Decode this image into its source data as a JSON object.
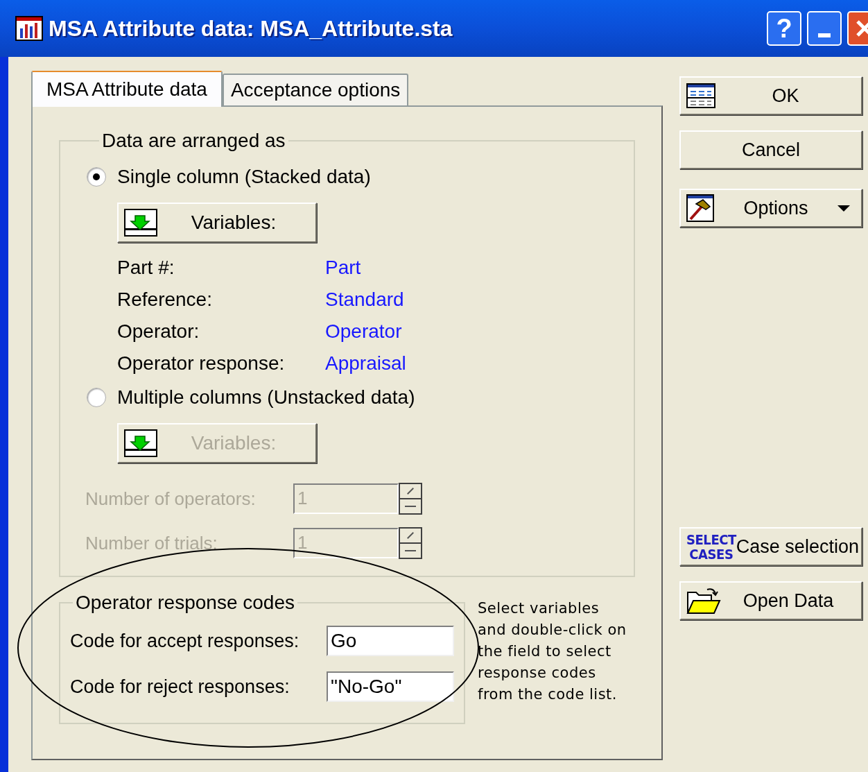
{
  "window": {
    "title": "MSA Attribute data: MSA_Attribute.sta"
  },
  "title_buttons": [
    {
      "kind": "help",
      "label": "?"
    },
    {
      "kind": "minimize"
    },
    {
      "kind": "close"
    }
  ],
  "tabs": [
    {
      "label": "MSA Attribute data",
      "selected": true
    },
    {
      "label": "Acceptance options",
      "selected": false
    }
  ],
  "arrangement": {
    "title": "Data are arranged as",
    "options": [
      {
        "label": "Single column (Stacked data)",
        "selected": true,
        "button": {
          "label": "Variables:",
          "disabled": false
        },
        "variables": [
          {
            "label": "Part #:",
            "value": "Part"
          },
          {
            "label": "Reference:",
            "value": "Standard"
          },
          {
            "label": "Operator:",
            "value": "Operator"
          },
          {
            "label": "Operator response:",
            "value": "Appraisal"
          }
        ]
      },
      {
        "label": "Multiple columns (Unstacked data)",
        "selected": false,
        "button": {
          "label": "Variables:",
          "disabled": true
        }
      }
    ],
    "spinners": [
      {
        "label": "Number of operators:",
        "value": "1",
        "disabled": true
      },
      {
        "label": "Number of trials:",
        "value": "1",
        "disabled": true
      }
    ]
  },
  "response_codes": {
    "title": "Operator response codes",
    "fields": [
      {
        "label": "Code for accept responses:",
        "value": "Go"
      },
      {
        "label": "Code for reject responses:",
        "value": "\"No-Go\""
      }
    ]
  },
  "hint": "Select variables and double-click on the field to select response codes from the code list.",
  "buttons": [
    {
      "kind": "ok",
      "label": "OK"
    },
    {
      "kind": "cancel",
      "label": "Cancel"
    },
    {
      "kind": "options",
      "label": "Options"
    },
    {
      "kind": "case_selection",
      "label": "Case selection",
      "icon_text": [
        "SELECT",
        "CASES"
      ]
    },
    {
      "kind": "open_data",
      "label": "Open Data"
    }
  ]
}
